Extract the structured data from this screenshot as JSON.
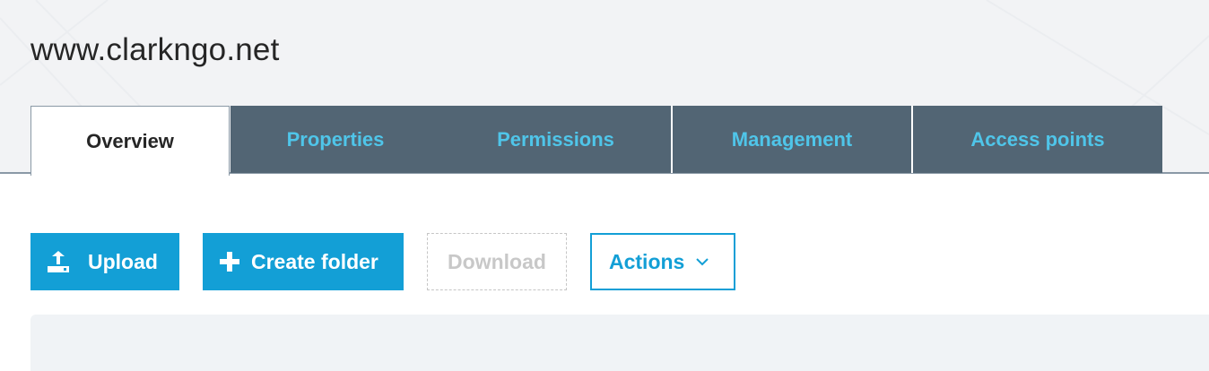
{
  "page": {
    "title": "www.clarkngo.net"
  },
  "tabs": [
    {
      "label": "Overview",
      "active": true
    },
    {
      "label": "Properties",
      "active": false
    },
    {
      "label": "Permissions",
      "active": false
    },
    {
      "label": "Management",
      "active": false
    },
    {
      "label": "Access points",
      "active": false
    }
  ],
  "toolbar": {
    "upload_label": "Upload",
    "upload_icon": "upload-icon",
    "create_folder_label": "Create folder",
    "create_folder_icon": "plus-icon",
    "download_label": "Download",
    "actions_label": "Actions",
    "actions_icon": "chevron-down-icon"
  },
  "colors": {
    "accent": "#139fd6",
    "tab_bar": "#526574",
    "tab_text": "#4fc5e9",
    "header_bg": "#f2f3f5",
    "panel_bg": "#f0f3f6"
  }
}
